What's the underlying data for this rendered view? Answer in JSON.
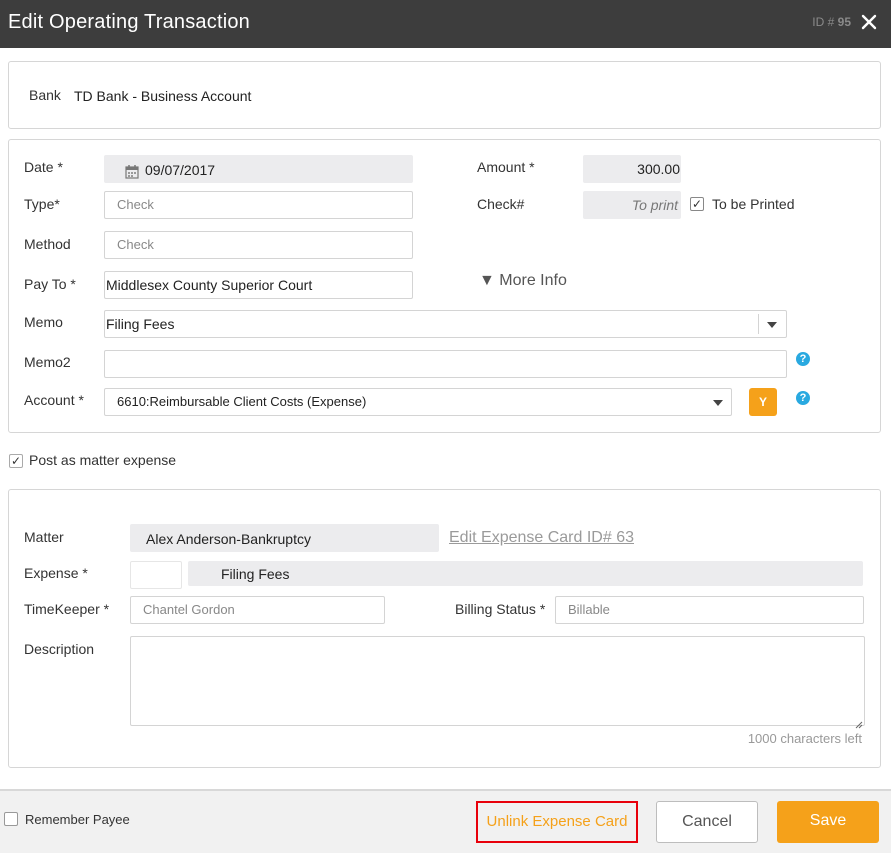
{
  "dialog": {
    "title": "Edit Operating Transaction",
    "id_label": "ID #",
    "id_value": "95",
    "close_icon": "close-icon"
  },
  "bank": {
    "label": "Bank",
    "value": "TD Bank - Business Account"
  },
  "transaction": {
    "date_label": "Date *",
    "date_value": "09/07/2017",
    "amount_label": "Amount *",
    "amount_value": "300.00",
    "type_label": "Type*",
    "type_placeholder": "Check",
    "check_label": "Check#",
    "check_placeholder": "To print",
    "to_be_printed_label": "To be Printed",
    "to_be_printed_checked": true,
    "method_label": "Method",
    "method_placeholder": "Check",
    "payto_label": "Pay To *",
    "payto_value": "Middlesex County Superior Court",
    "more_info_label": "▼ More Info",
    "memo_label": "Memo",
    "memo_value": "Filing Fees",
    "memo2_label": "Memo2",
    "memo2_value": "",
    "account_label": "Account *",
    "account_value": "6610:Reimbursable Client Costs (Expense)",
    "account_btn": "Y"
  },
  "post_expense": {
    "label": "Post as matter expense",
    "checked": true
  },
  "expense": {
    "matter_label": "Matter",
    "matter_value": "Alex Anderson-Bankruptcy",
    "edit_link": "Edit Expense Card ID# 63",
    "expense_label": "Expense *",
    "expense_code": "",
    "expense_value": "Filing Fees",
    "timekeeper_label": "TimeKeeper *",
    "timekeeper_value": "Chantel Gordon",
    "billing_label": "Billing Status *",
    "billing_value": "Billable",
    "description_label": "Description",
    "description_value": "",
    "chars_left": "1000 characters left"
  },
  "footer": {
    "remember_label": "Remember Payee",
    "remember_checked": false,
    "unlink_label": "Unlink Expense Card",
    "cancel_label": "Cancel",
    "save_label": "Save"
  },
  "colors": {
    "titlebar": "#3d3d3d",
    "accent": "#f5a11a",
    "highlight": "#e8000b",
    "link": "#9a9a9a",
    "help": "#29a9e0"
  }
}
